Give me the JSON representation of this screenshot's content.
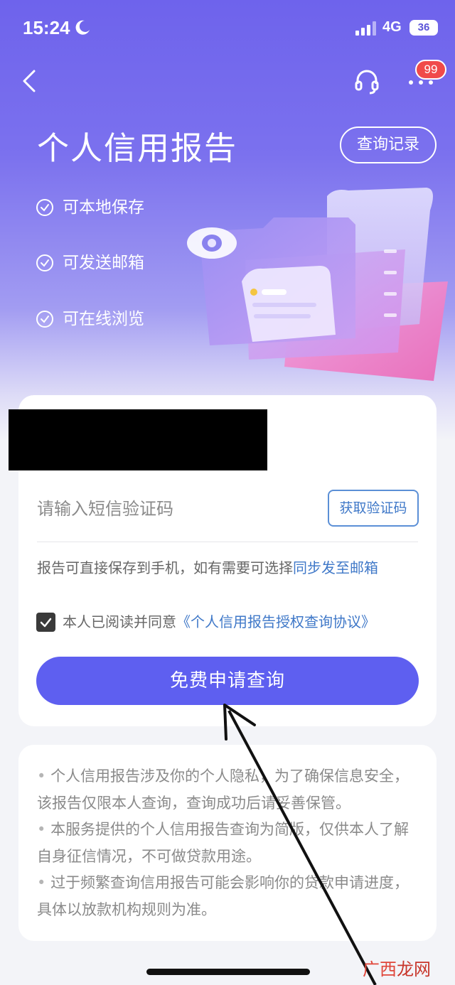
{
  "status_bar": {
    "time": "15:24",
    "network": "4G",
    "battery": "36"
  },
  "nav": {
    "more_badge": "99"
  },
  "header": {
    "title": "个人信用报告",
    "history_button": "查询记录"
  },
  "features": [
    {
      "label": "可本地保存"
    },
    {
      "label": "可发送邮箱"
    },
    {
      "label": "可在线浏览"
    }
  ],
  "form": {
    "sms_placeholder": "请输入短信验证码",
    "get_code_button": "获取验证码",
    "note_prefix": "报告可直接保存到手机，如有需要可选择",
    "note_link": "同步发至邮箱",
    "agreement_prefix": "本人已阅读并同意",
    "agreement_link": "《个人信用报告授权查询协议》",
    "agreement_checked": true,
    "submit_button": "免费申请查询"
  },
  "tips": [
    "个人信用报告涉及你的个人隐私，为了确保信息安全，该报告仅限本人查询，查询成功后请妥善保管。",
    "本服务提供的个人信用报告查询为简版，仅供本人了解自身征信情况，不可做贷款用途。",
    "过于频繁查询信用报告可能会影响你的贷款申请进度，具体以放款机构规则为准。"
  ],
  "watermark": {
    "part1": "广西",
    "part2": "龙网"
  },
  "colors": {
    "accent": "#5e5ff0",
    "link": "#3f78c8",
    "hero_top": "#6e63ec",
    "badge": "#f04a4a"
  }
}
